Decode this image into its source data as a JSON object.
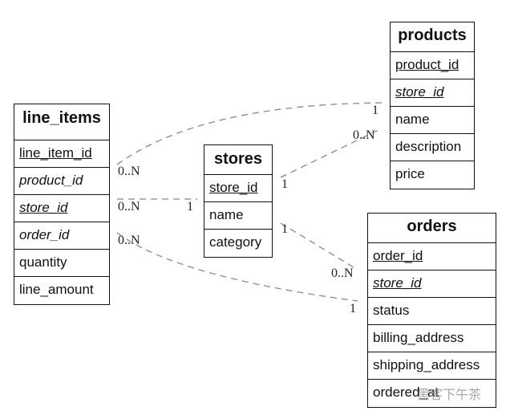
{
  "entities": {
    "line_items": {
      "title": "line_items",
      "fields": [
        {
          "name": "line_item_id",
          "kind": "pk"
        },
        {
          "name": "product_id",
          "kind": "fk"
        },
        {
          "name": "store_id",
          "kind": "pkfk"
        },
        {
          "name": "order_id",
          "kind": "fk"
        },
        {
          "name": "quantity",
          "kind": "plain"
        },
        {
          "name": "line_amount",
          "kind": "plain"
        }
      ]
    },
    "stores": {
      "title": "stores",
      "fields": [
        {
          "name": "store_id",
          "kind": "pk"
        },
        {
          "name": "name",
          "kind": "plain"
        },
        {
          "name": "category",
          "kind": "plain"
        }
      ]
    },
    "products": {
      "title": "products",
      "fields": [
        {
          "name": "product_id",
          "kind": "pk"
        },
        {
          "name": "store_id",
          "kind": "pkfk"
        },
        {
          "name": "name",
          "kind": "plain"
        },
        {
          "name": "description",
          "kind": "plain"
        },
        {
          "name": "price",
          "kind": "plain"
        }
      ]
    },
    "orders": {
      "title": "orders",
      "fields": [
        {
          "name": "order_id",
          "kind": "pk"
        },
        {
          "name": "store_id",
          "kind": "pkfk"
        },
        {
          "name": "status",
          "kind": "plain"
        },
        {
          "name": "billing_address",
          "kind": "plain"
        },
        {
          "name": "shipping_address",
          "kind": "plain"
        },
        {
          "name": "ordered_at",
          "kind": "plain"
        }
      ]
    }
  },
  "relationships": [
    {
      "from": "line_items",
      "to": "products",
      "from_card": "0..N",
      "to_card": "1"
    },
    {
      "from": "line_items",
      "to": "stores",
      "from_card": "0..N",
      "to_card": "1"
    },
    {
      "from": "line_items",
      "to": "orders",
      "from_card": "0..N",
      "to_card": "1"
    },
    {
      "from": "stores",
      "to": "products",
      "from_card": "1",
      "to_card": "0..N"
    },
    {
      "from": "stores",
      "to": "orders",
      "from_card": "1",
      "to_card": "0..N"
    }
  ],
  "watermark": "黑客下午茶",
  "colors": {
    "border": "#111111",
    "link": "#888888"
  }
}
